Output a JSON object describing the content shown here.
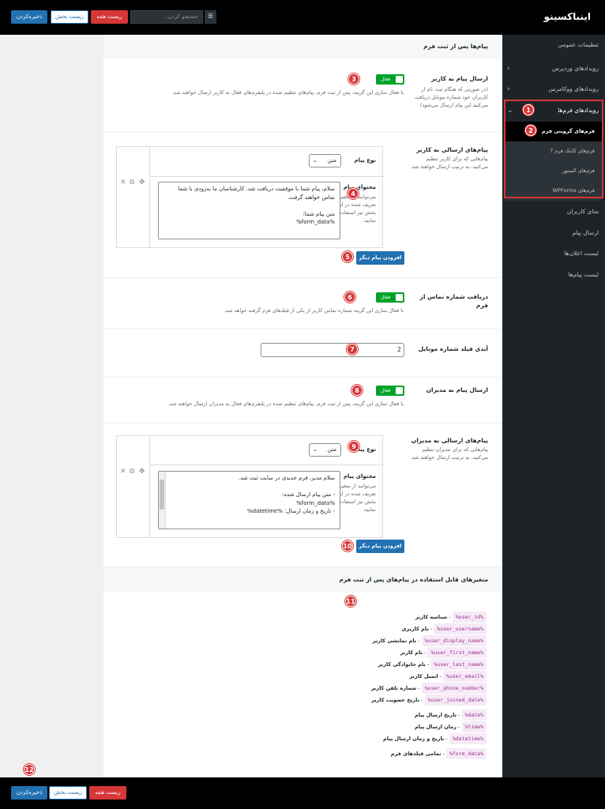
{
  "header": {
    "brand": "اینباکسینو",
    "save_label": "ذخیره‌کردن",
    "reset_section_label": "ریست بخش",
    "reset_all_label": "ریست همه",
    "search_placeholder": "جستجو کردن...",
    "menu_icon": "list-icon"
  },
  "sidebar": {
    "items": [
      {
        "label": "تنظیمات عمومی"
      },
      {
        "label": "رویدادهای وردپرس"
      },
      {
        "label": "رویدادهای ووکامرس"
      },
      {
        "label": "رویدادهای فرم‌ها"
      },
      {
        "label": "متای کاربران"
      },
      {
        "label": "ارسال پیام"
      },
      {
        "label": "لیست اعلان‌ها"
      },
      {
        "label": "لیست پیام‌ها"
      }
    ],
    "submenu": [
      {
        "label": "فرم‌های گرویتی فرم"
      },
      {
        "label": "فرم‌های کانتک فرم 7"
      },
      {
        "label": "فرم‌های المنتور"
      },
      {
        "label": "فرم‌های WPForms"
      }
    ]
  },
  "badges": [
    "1",
    "2",
    "3",
    "4",
    "5",
    "6",
    "7",
    "8",
    "9",
    "10",
    "11",
    "12"
  ],
  "main": {
    "section_title": "پیام‌ها پس از ثبت فرم",
    "user_msg": {
      "label": "ارسال پیام به کاربر",
      "toggle": "فعال",
      "desc": "با فعال سازی این گزینه، پس از ثبت فرم، پیام‌های تنظیم شده در پلتفرم‌های فعال به کاربر ارسال خواهند شد.",
      "note": "(در صورتی که هنگام ثبت نام از کاربران خود شماره موبایل دریافت می‌کنید این پیام ارسال می‌شود)"
    },
    "user_messages": {
      "label": "پیام‌های ارسالی به کاربر",
      "desc": "پیام‌هایی که برای کاربر تنظیم می‌کنید، به ترتیب ارسال خواهند شد.",
      "type_label": "نوع پیام",
      "type_value": "متن",
      "content_label": "محتوای پیام",
      "content_help": "می‌توانید از متغیرهای تعریف شده در این بخش نیز استفاده نمایید.",
      "content": "سلام، پیام شما با موفقیت دریافت شد. کارشناسان ما به‌زودی با شما تماس خواهند گرفت.\n\nمتن پیام شما:\n%form_data%",
      "add_button": "افزودن پیام دیگر"
    },
    "phone_field": {
      "label": "دریافت شماره تماس از فرم",
      "toggle": "فعال",
      "desc": "با فعال سازی این گزینه شماره تماس کاربر از یکی از فیلدهای فرم گرفته خواهد شد."
    },
    "mobile_id": {
      "label": "آیدی فیلد شماره موبایل",
      "value": "2"
    },
    "admin_msg": {
      "label": "ارسال پیام به مدیران",
      "toggle": "فعال",
      "desc": "با فعال سازی این گزینه، پس از ثبت فرم، پیام‌های تنظیم شده در پلتفرم‌های فعال به مدیران ارسال خواهند شد."
    },
    "admin_messages": {
      "label": "پیام‌های ارسالی به مدیران",
      "desc": "پیام‌هایی که برای مدیران تنظیم می‌کنید، به ترتیب ارسال خواهند شد.",
      "type_label": "نوع پیام",
      "type_value": "متن",
      "content_label": "محتوای پیام",
      "content_help": "می‌توانید از متغیرهای تعریف شده در این بخش نیز استفاده نمایید.",
      "content": "سلام مدیر، فرم جدیدی در سایت ثبت شد.\n\n- متن پیام ارسال شده:\n%form_data%\n- تاریخ و زمان ارسال: %datetime%",
      "add_button": "افزودن پیام دیگر"
    },
    "variables_title": "متغیرهای قابل استفاده در پیام‌های پس از ثبت فرم",
    "variables": [
      {
        "tag": "%user_id%",
        "desc": "شناسه کاربر"
      },
      {
        "tag": "%user_username%",
        "desc": "نام کاربری"
      },
      {
        "tag": "%user_display_name%",
        "desc": "نام نمایشی کاربر"
      },
      {
        "tag": "%user_first_name%",
        "desc": "نام کاربر"
      },
      {
        "tag": "%user_last_name%",
        "desc": "نام خانوادگی کاربر"
      },
      {
        "tag": "%user_email%",
        "desc": "ایمیل کاربر"
      },
      {
        "tag": "%user_phone_number%",
        "desc": "شماره تلفن کاربر"
      },
      {
        "tag": "%user_joined_date%",
        "desc": "تاریخ عضویت کاربر"
      },
      {
        "tag": "%date%",
        "desc": "تاریخ ارسال پیام"
      },
      {
        "tag": "%time%",
        "desc": "زمان ارسال پیام"
      },
      {
        "tag": "%datetime%",
        "desc": "تاریخ و زمان ارسال پیام"
      },
      {
        "tag": "%form_data%",
        "desc": "تمامی فیلدهای فرم"
      }
    ],
    "separator": "-"
  }
}
